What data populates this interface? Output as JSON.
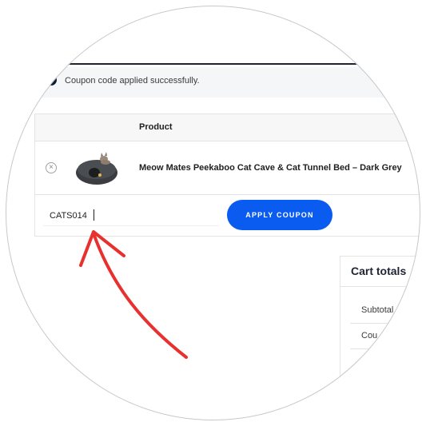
{
  "notice": {
    "message": "Coupon code applied successfully."
  },
  "cart": {
    "columns": [
      "Product"
    ],
    "items": [
      {
        "name": "Meow Mates Peekaboo Cat Cave & Cat Tunnel Bed – Dark Grey"
      }
    ],
    "remove_symbol": "×"
  },
  "coupon": {
    "value": "CATS014",
    "apply_label": "APPLY COUPON"
  },
  "totals": {
    "title": "Cart totals",
    "rows": [
      "Subtotal",
      "Cou"
    ]
  },
  "colors": {
    "accent": "#0a5cf0",
    "arrow": "#e8312f",
    "heading": "#1e2433"
  },
  "icons": {
    "notice": "info-circle-icon",
    "remove": "remove-circle-icon",
    "annotation": "red-arrow-icon"
  }
}
